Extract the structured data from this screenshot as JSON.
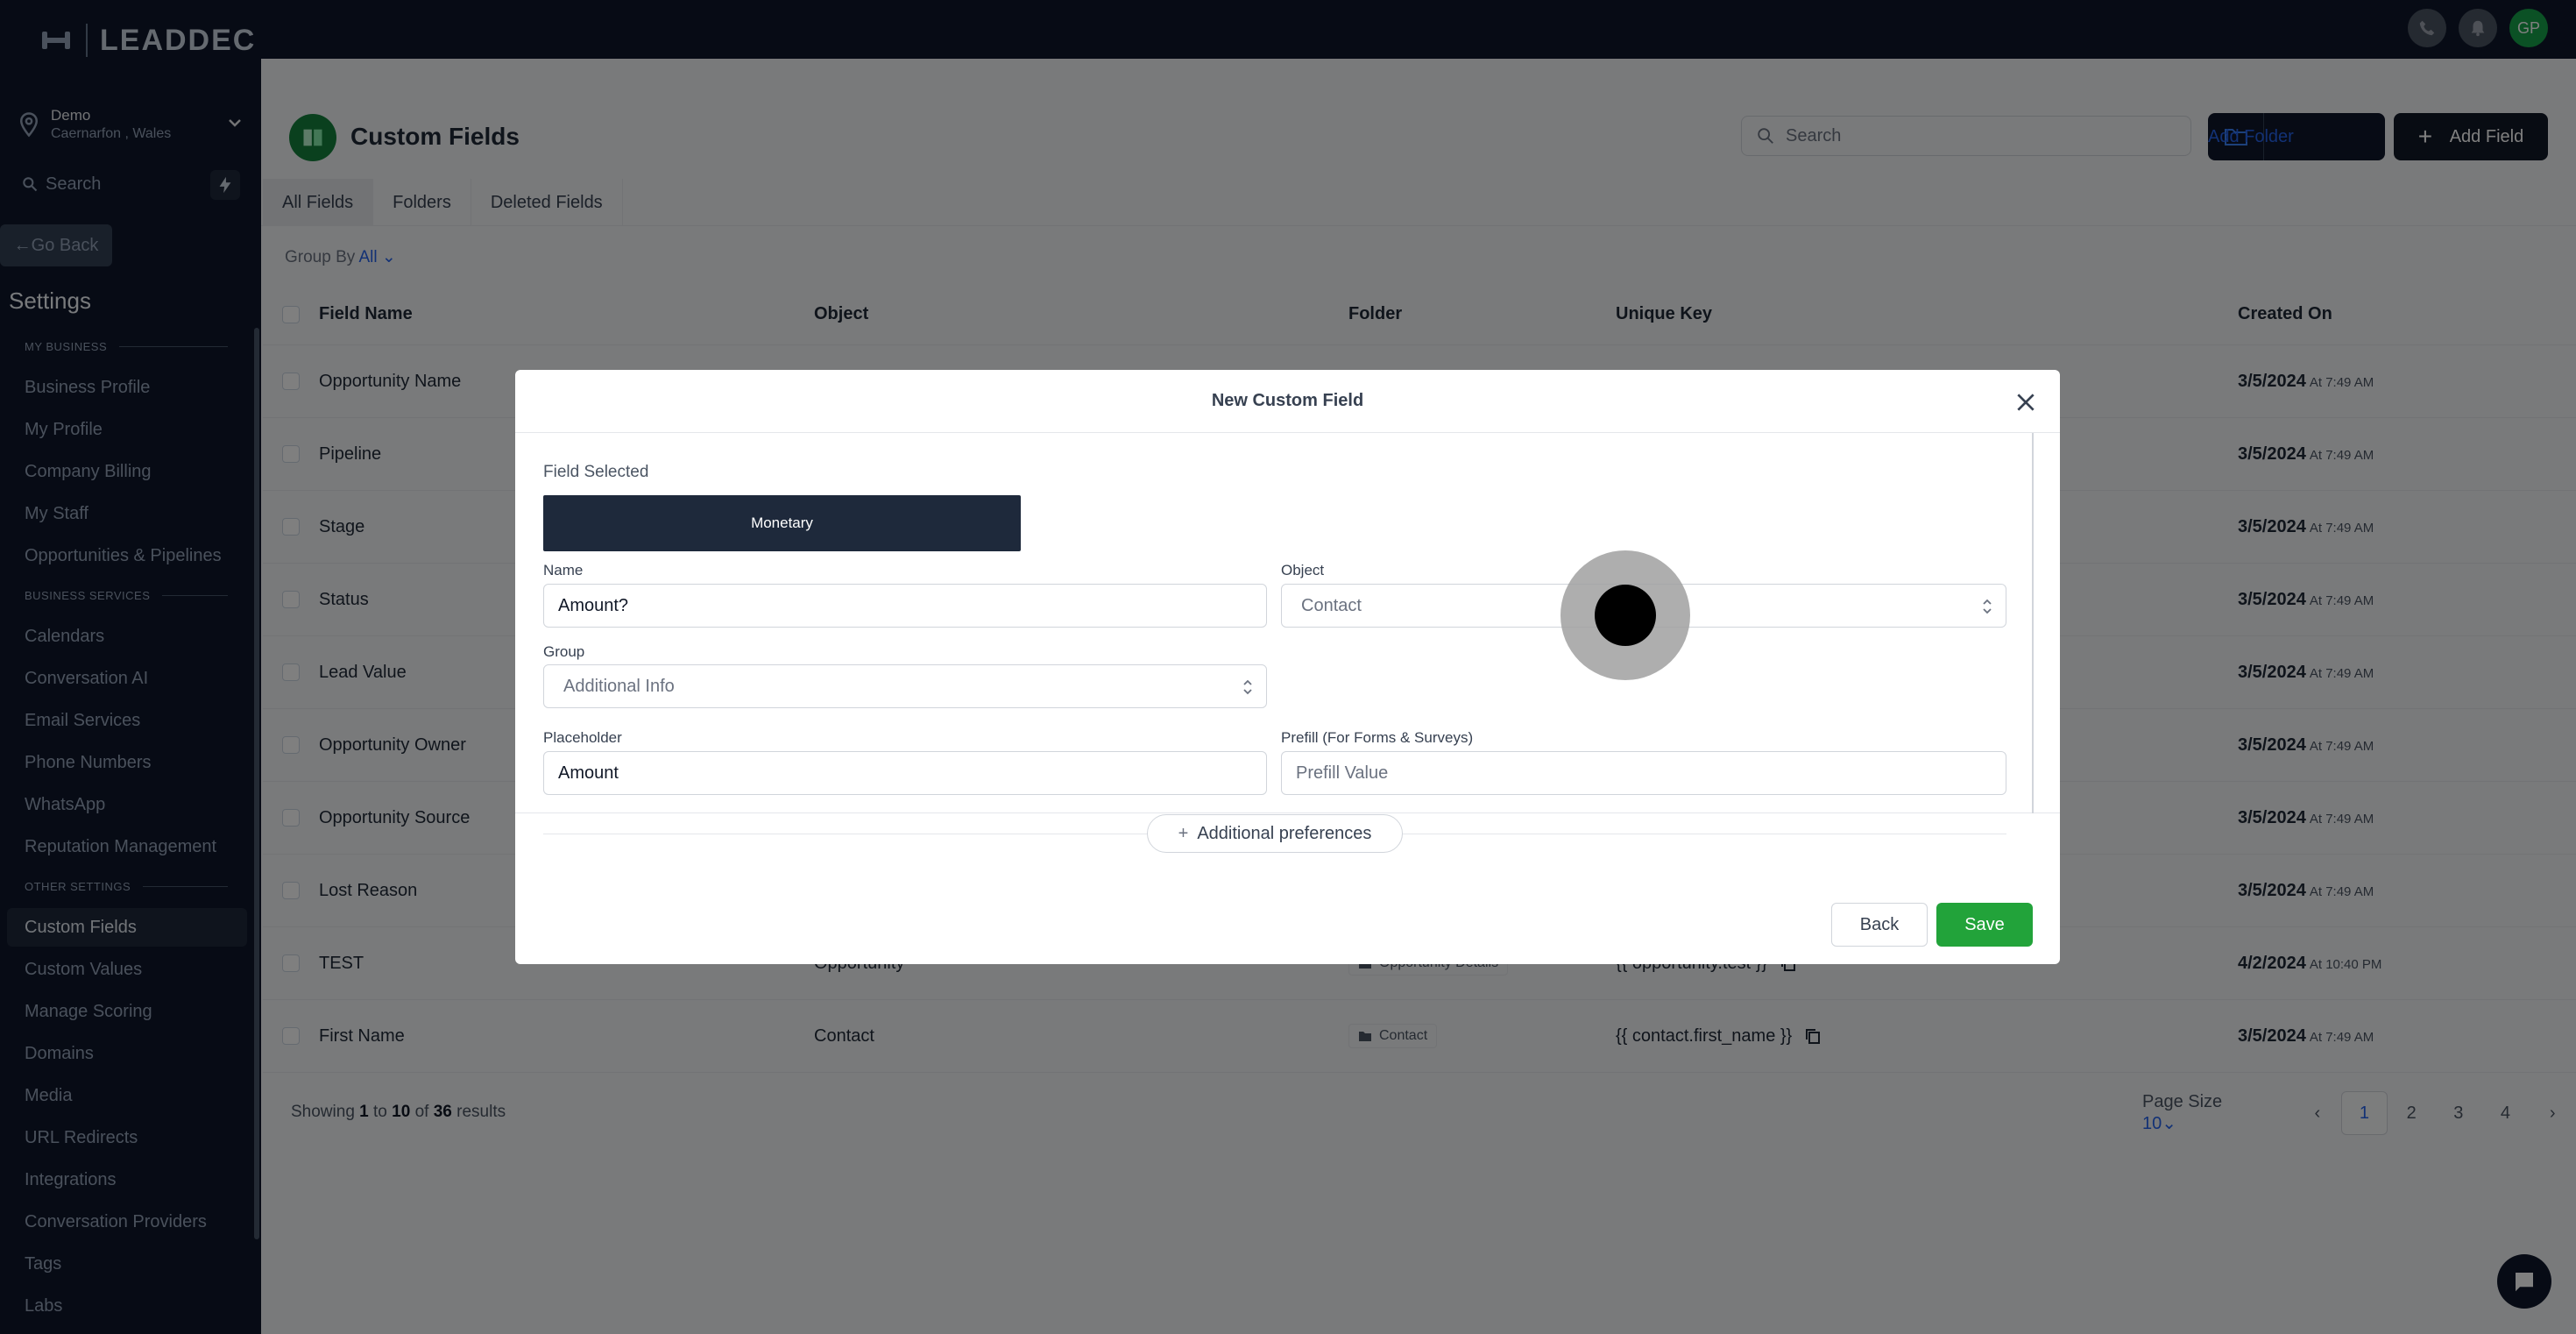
{
  "topbar": {
    "avatar_initials": "GP",
    "icons": [
      "phone-icon",
      "bell-icon"
    ]
  },
  "sidebar": {
    "logo_text": "LEADDEC",
    "location_name": "Demo",
    "location_sub": "Caernarfon , Wales",
    "search_placeholder": "Search",
    "go_back": "Go Back",
    "settings_title": "Settings",
    "sections": {
      "my_business": "MY BUSINESS",
      "business_services": "BUSINESS SERVICES",
      "other_settings": "OTHER SETTINGS"
    },
    "my_business_items": [
      "Business Profile",
      "My Profile",
      "Company Billing",
      "My Staff",
      "Opportunities & Pipelines"
    ],
    "business_services_items": [
      "Calendars",
      "Conversation AI",
      "Email Services",
      "Phone Numbers",
      "WhatsApp",
      "Reputation Management"
    ],
    "other_settings_items": [
      "Custom Fields",
      "Custom Values",
      "Manage Scoring",
      "Domains",
      "Media",
      "URL Redirects",
      "Integrations",
      "Conversation Providers",
      "Tags",
      "Labs"
    ],
    "active_item": "Custom Fields"
  },
  "page": {
    "title": "Custom Fields",
    "search_placeholder": "Search",
    "add_folder": "Add Folder",
    "add_field": "Add Field",
    "tabs": [
      "All Fields",
      "Folders",
      "Deleted Fields"
    ],
    "group_by_label": "Group By",
    "group_by_value": "All"
  },
  "table": {
    "headers": [
      "Field Name",
      "Object",
      "Folder",
      "Unique Key",
      "Created On"
    ],
    "rows": [
      {
        "name": "Opportunity Name",
        "object": "",
        "folder": "",
        "key": "",
        "date": "3/5/2024",
        "time": "At 7:49 AM"
      },
      {
        "name": "Pipeline",
        "object": "",
        "folder": "",
        "key": "",
        "date": "3/5/2024",
        "time": "At 7:49 AM"
      },
      {
        "name": "Stage",
        "object": "",
        "folder": "",
        "key": "",
        "date": "3/5/2024",
        "time": "At 7:49 AM"
      },
      {
        "name": "Status",
        "object": "",
        "folder": "",
        "key": "",
        "date": "3/5/2024",
        "time": "At 7:49 AM"
      },
      {
        "name": "Lead Value",
        "object": "",
        "folder": "",
        "key": "",
        "date": "3/5/2024",
        "time": "At 7:49 AM"
      },
      {
        "name": "Opportunity Owner",
        "object": "",
        "folder": "",
        "key": "",
        "date": "3/5/2024",
        "time": "At 7:49 AM"
      },
      {
        "name": "Opportunity Source",
        "object": "",
        "folder": "",
        "key": "",
        "date": "3/5/2024",
        "time": "At 7:49 AM"
      },
      {
        "name": "Lost Reason",
        "object": "",
        "folder": "",
        "key": "",
        "date": "3/5/2024",
        "time": "At 7:49 AM"
      },
      {
        "name": "TEST",
        "object": "Opportunity",
        "folder": "Opportunity Details",
        "key": "{{ opportunity.test }}",
        "date": "4/2/2024",
        "time": "At 10:40 PM"
      },
      {
        "name": "First Name",
        "object": "Contact",
        "folder": "Contact",
        "key": "{{ contact.first_name }}",
        "date": "3/5/2024",
        "time": "At 7:49 AM"
      }
    ]
  },
  "pagination": {
    "showing_prefix": "Showing",
    "from": "1",
    "to_word": "to",
    "to": "10",
    "of_word": "of",
    "total": "36",
    "results_word": "results",
    "page_size_label": "Page Size",
    "page_size_value": "10",
    "pages": [
      "1",
      "2",
      "3",
      "4"
    ],
    "current_page": "1"
  },
  "modal": {
    "title": "New Custom Field",
    "field_selected_label": "Field Selected",
    "field_type": "Monetary",
    "name_label": "Name",
    "name_value": "Amount?",
    "object_label": "Object",
    "object_value": "Contact",
    "group_label": "Group",
    "group_value": "Additional Info",
    "placeholder_label": "Placeholder",
    "placeholder_value": "Amount",
    "prefill_label": "Prefill (For Forms & Surveys)",
    "prefill_placeholder": "Prefill Value",
    "additional_preferences": "Additional preferences",
    "back": "Back",
    "save": "Save"
  }
}
